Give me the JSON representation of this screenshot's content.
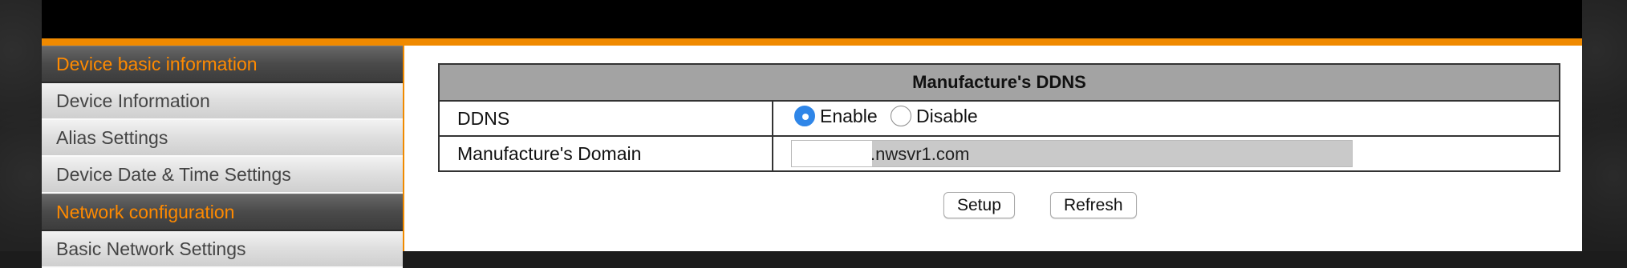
{
  "sidebar": {
    "sections": [
      {
        "title": "Device basic information",
        "items": [
          "Device Information",
          "Alias Settings",
          "Device Date & Time Settings"
        ]
      },
      {
        "title": "Network configuration",
        "items": [
          "Basic Network Settings"
        ]
      }
    ]
  },
  "panel": {
    "title": "Manufacture's DDNS",
    "rows": [
      {
        "label": "DDNS",
        "options": [
          "Enable",
          "Disable"
        ],
        "selected": "Enable"
      },
      {
        "label": "Manufacture's Domain",
        "value": ".nwsvr1.com"
      }
    ]
  },
  "buttons": {
    "setup": "Setup",
    "refresh": "Refresh"
  },
  "colors": {
    "accent": "#f08a00",
    "radio_selected": "#2f86e8",
    "header_bg": "#a3a3a3"
  }
}
